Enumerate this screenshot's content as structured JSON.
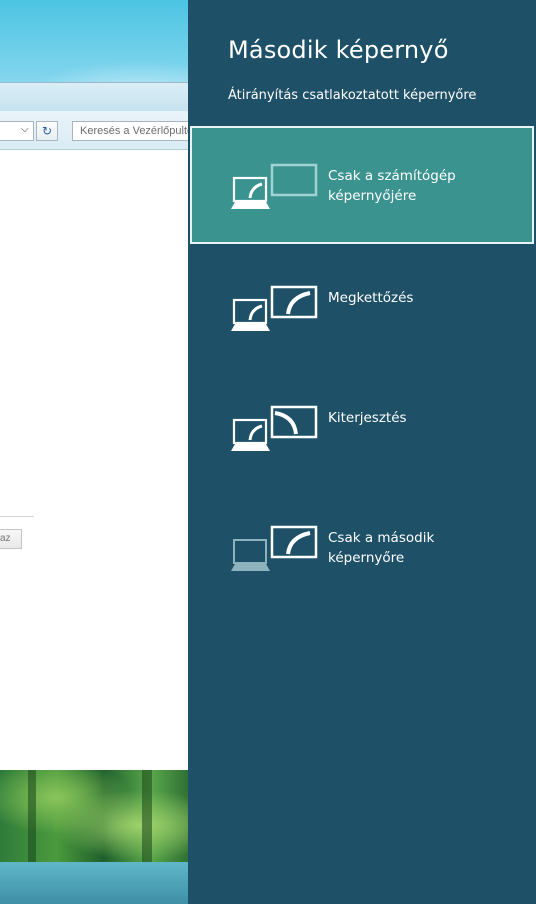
{
  "background_window": {
    "search_placeholder": "Keresés a Vezérlőpulton",
    "partial_button_label": "az"
  },
  "panel": {
    "title": "Második képernyő",
    "subtitle": "Átirányítás csatlakoztatott képernyőre",
    "options": [
      {
        "label_line1": "Csak a számítógép",
        "label_line2": "képernyőjére",
        "selected": true,
        "icon": "pc-screen-only-icon"
      },
      {
        "label_line1": "Megkettőzés",
        "label_line2": "",
        "selected": false,
        "icon": "duplicate-icon"
      },
      {
        "label_line1": "Kiterjesztés",
        "label_line2": "",
        "selected": false,
        "icon": "extend-icon"
      },
      {
        "label_line1": "Csak a második",
        "label_line2": "képernyőre",
        "selected": false,
        "icon": "second-screen-only-icon"
      }
    ]
  },
  "colors": {
    "panel_background": "#1e5067",
    "selected_background": "#3b9390",
    "text": "#ffffff"
  }
}
